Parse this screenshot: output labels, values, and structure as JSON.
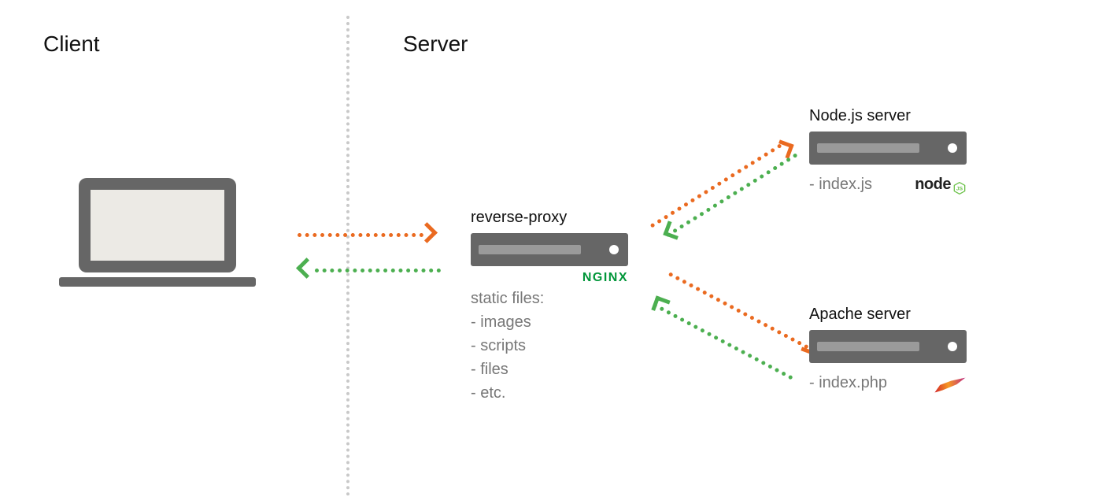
{
  "sections": {
    "client_heading": "Client",
    "server_heading": "Server"
  },
  "proxy": {
    "label": "reverse-proxy",
    "tech_logo_text": "NGINX",
    "static_title": "static files:",
    "static_items": [
      "- images",
      "- scripts",
      "- files",
      "- etc."
    ]
  },
  "backends": {
    "node": {
      "title": "Node.js server",
      "file": "- index.js",
      "logo_text": "node"
    },
    "apache": {
      "title": "Apache server",
      "file": "- index.php"
    }
  },
  "colors": {
    "request": "#ea6a20",
    "response": "#4caf50",
    "box": "#666666",
    "muted_text": "#777777",
    "nginx_brand": "#009639"
  }
}
